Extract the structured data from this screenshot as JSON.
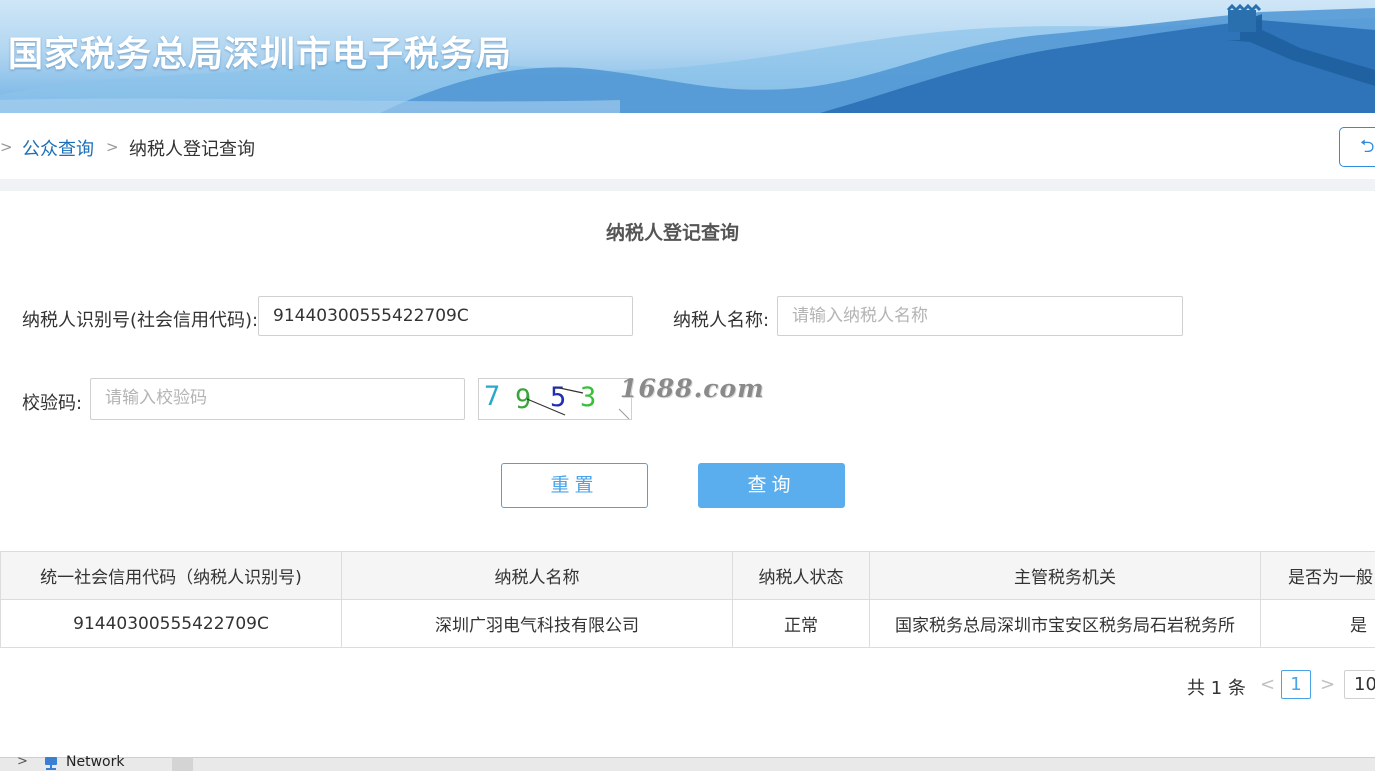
{
  "banner": {
    "title": "国家税务总局深圳市电子税务局"
  },
  "breadcrumb": {
    "leading_sep": ">",
    "sep": ">",
    "parent": "公众查询",
    "current": "纳税人登记查询"
  },
  "back_button": {
    "label": "⮌"
  },
  "form": {
    "title": "纳税人登记查询",
    "taxpayer_id_label": "纳税人识别号(社会信用代码):",
    "taxpayer_id_value": "91440300555422709C",
    "taxpayer_name_label": "纳税人名称:",
    "taxpayer_name_placeholder": "请输入纳税人名称",
    "captcha_label": "校验码:",
    "captcha_placeholder": "请输入校验码",
    "captcha_digits": [
      "7",
      "9",
      "5",
      "3"
    ],
    "captcha_colors": [
      "#27a9c9",
      "#3aa33a",
      "#1f2fb4",
      "#36c236"
    ],
    "watermark": "1688.com",
    "reset_label": "重置",
    "query_label": "查询"
  },
  "table": {
    "headers": [
      "统一社会信用代码（纳税人识别号)",
      "纳税人名称",
      "纳税人状态",
      "主管税务机关",
      "是否为一般"
    ],
    "rows": [
      [
        "91440300555422709C",
        "深圳广羽电气科技有限公司",
        "正常",
        "国家税务总局深圳市宝安区税务局石岩税务所",
        "是"
      ]
    ]
  },
  "pagination": {
    "total": "共 1 条",
    "prev": "<",
    "current_page": "1",
    "next": ">",
    "page_size": "10"
  },
  "taskbar": {
    "network_label": "Network",
    "tree_arrow": ">"
  },
  "colors": {
    "accent": "#2f8ce0",
    "button_primary": "#5aaeee",
    "link": "#1a6fb8"
  }
}
